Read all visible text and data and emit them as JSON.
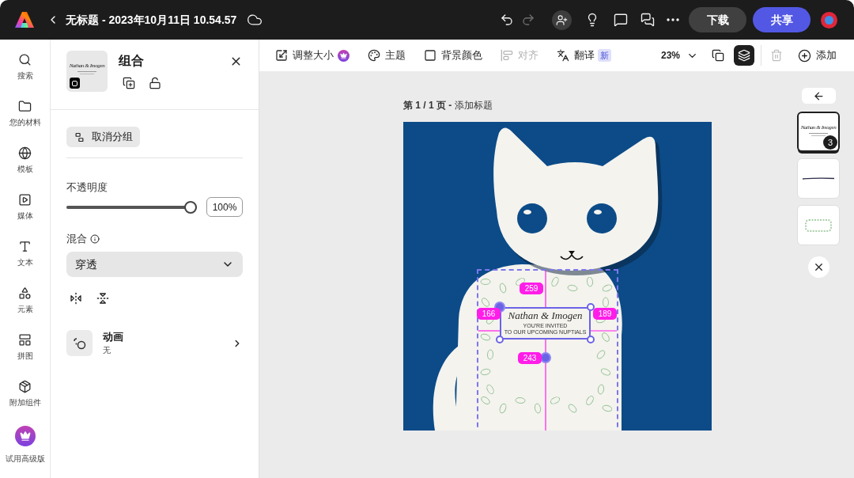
{
  "app_bar": {
    "title": "无标题 - 2023年10月11日 10.54.57",
    "undo": {
      "disabled": false
    },
    "redo": {
      "disabled": true
    },
    "buttons": [
      {
        "label": "下载",
        "kind": "secondary"
      },
      {
        "label": "共享",
        "kind": "primary"
      }
    ]
  },
  "sidebar": {
    "items": [
      {
        "kind": "search",
        "label": "搜索"
      },
      {
        "kind": "files",
        "label": "您的材料"
      },
      {
        "kind": "templates",
        "label": "模板"
      },
      {
        "kind": "media",
        "label": "媒体"
      },
      {
        "kind": "text",
        "label": "文本"
      },
      {
        "kind": "elements",
        "label": "元素"
      },
      {
        "kind": "grids",
        "label": "拼图"
      },
      {
        "kind": "addons",
        "label": "附加组件"
      },
      {
        "kind": "premium",
        "label": "试用高级版"
      }
    ]
  },
  "properties_panel": {
    "title": "组合",
    "thumbnail_text": "Nathan & Imogen",
    "ungroup": "取消分组",
    "opacity": {
      "label": "不透明度",
      "level": 1,
      "value": "100%"
    },
    "blend": {
      "label": "混合",
      "value": "穿透"
    },
    "animation": {
      "label": "动画",
      "value": "无"
    }
  },
  "toolbar": {
    "items": [
      {
        "kind": "resize",
        "label": "调整大小",
        "premium": true,
        "disabled": false
      },
      {
        "kind": "theme",
        "label": "主题",
        "disabled": false
      },
      {
        "kind": "background",
        "label": "背景颜色",
        "disabled": false
      },
      {
        "kind": "align",
        "label": "对齐",
        "disabled": true
      },
      {
        "kind": "translate",
        "label": "翻译",
        "badge": "新",
        "disabled": false
      }
    ],
    "zoom": "23%",
    "view_toggles": [
      {
        "kind": "pages",
        "selected": false
      },
      {
        "kind": "layers",
        "selected": true
      }
    ],
    "delete": {
      "disabled": true
    },
    "add": "添加"
  },
  "canvas": {
    "page_label": "**第 1 / 1 页 -** 添加标题",
    "design": {
      "title": "Nathan & Imogen",
      "subtitle": [
        "YOU'RE INVITED",
        "TO OUR UPCOMING NUPTIALS"
      ],
      "distances": [
        "259",
        "166",
        "189",
        "243"
      ]
    }
  },
  "layers_panel": {
    "layers": [
      {
        "kind": "group",
        "text": "Nathan & Imogen",
        "count": "3",
        "selected": true
      },
      {
        "kind": "line",
        "selected": false
      },
      {
        "kind": "wreath",
        "selected": false
      }
    ]
  }
}
